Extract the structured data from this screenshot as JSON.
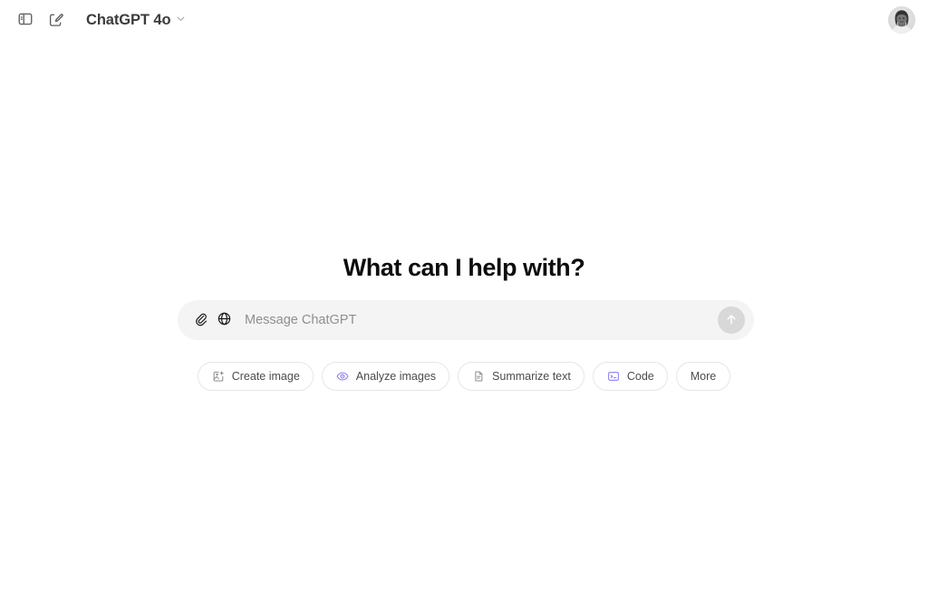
{
  "app": {
    "background_color": "#ffffff",
    "accent_purple": "#8A7DF0"
  },
  "topbar": {
    "sidebar_toggle_name": "Toggle sidebar",
    "new_chat_name": "New chat",
    "model_label": "ChatGPT 4o",
    "model_chevron": "chevron-down-icon",
    "avatar_name": "User account"
  },
  "main": {
    "headline": "What can I help with?"
  },
  "composer": {
    "attach_label": "Attach file",
    "search_label": "Search the web",
    "placeholder": "Message ChatGPT",
    "value": "",
    "send_label": "Send message",
    "send_enabled": false
  },
  "suggestions": [
    {
      "label": "Create image",
      "icon": "image-sparkle-icon",
      "icon_color": "gray"
    },
    {
      "label": "Analyze images",
      "icon": "eye-icon",
      "icon_color": "purple"
    },
    {
      "label": "Summarize text",
      "icon": "document-icon",
      "icon_color": "gray"
    },
    {
      "label": "Code",
      "icon": "terminal-icon",
      "icon_color": "purple"
    },
    {
      "label": "More",
      "icon": "",
      "icon_color": ""
    }
  ]
}
